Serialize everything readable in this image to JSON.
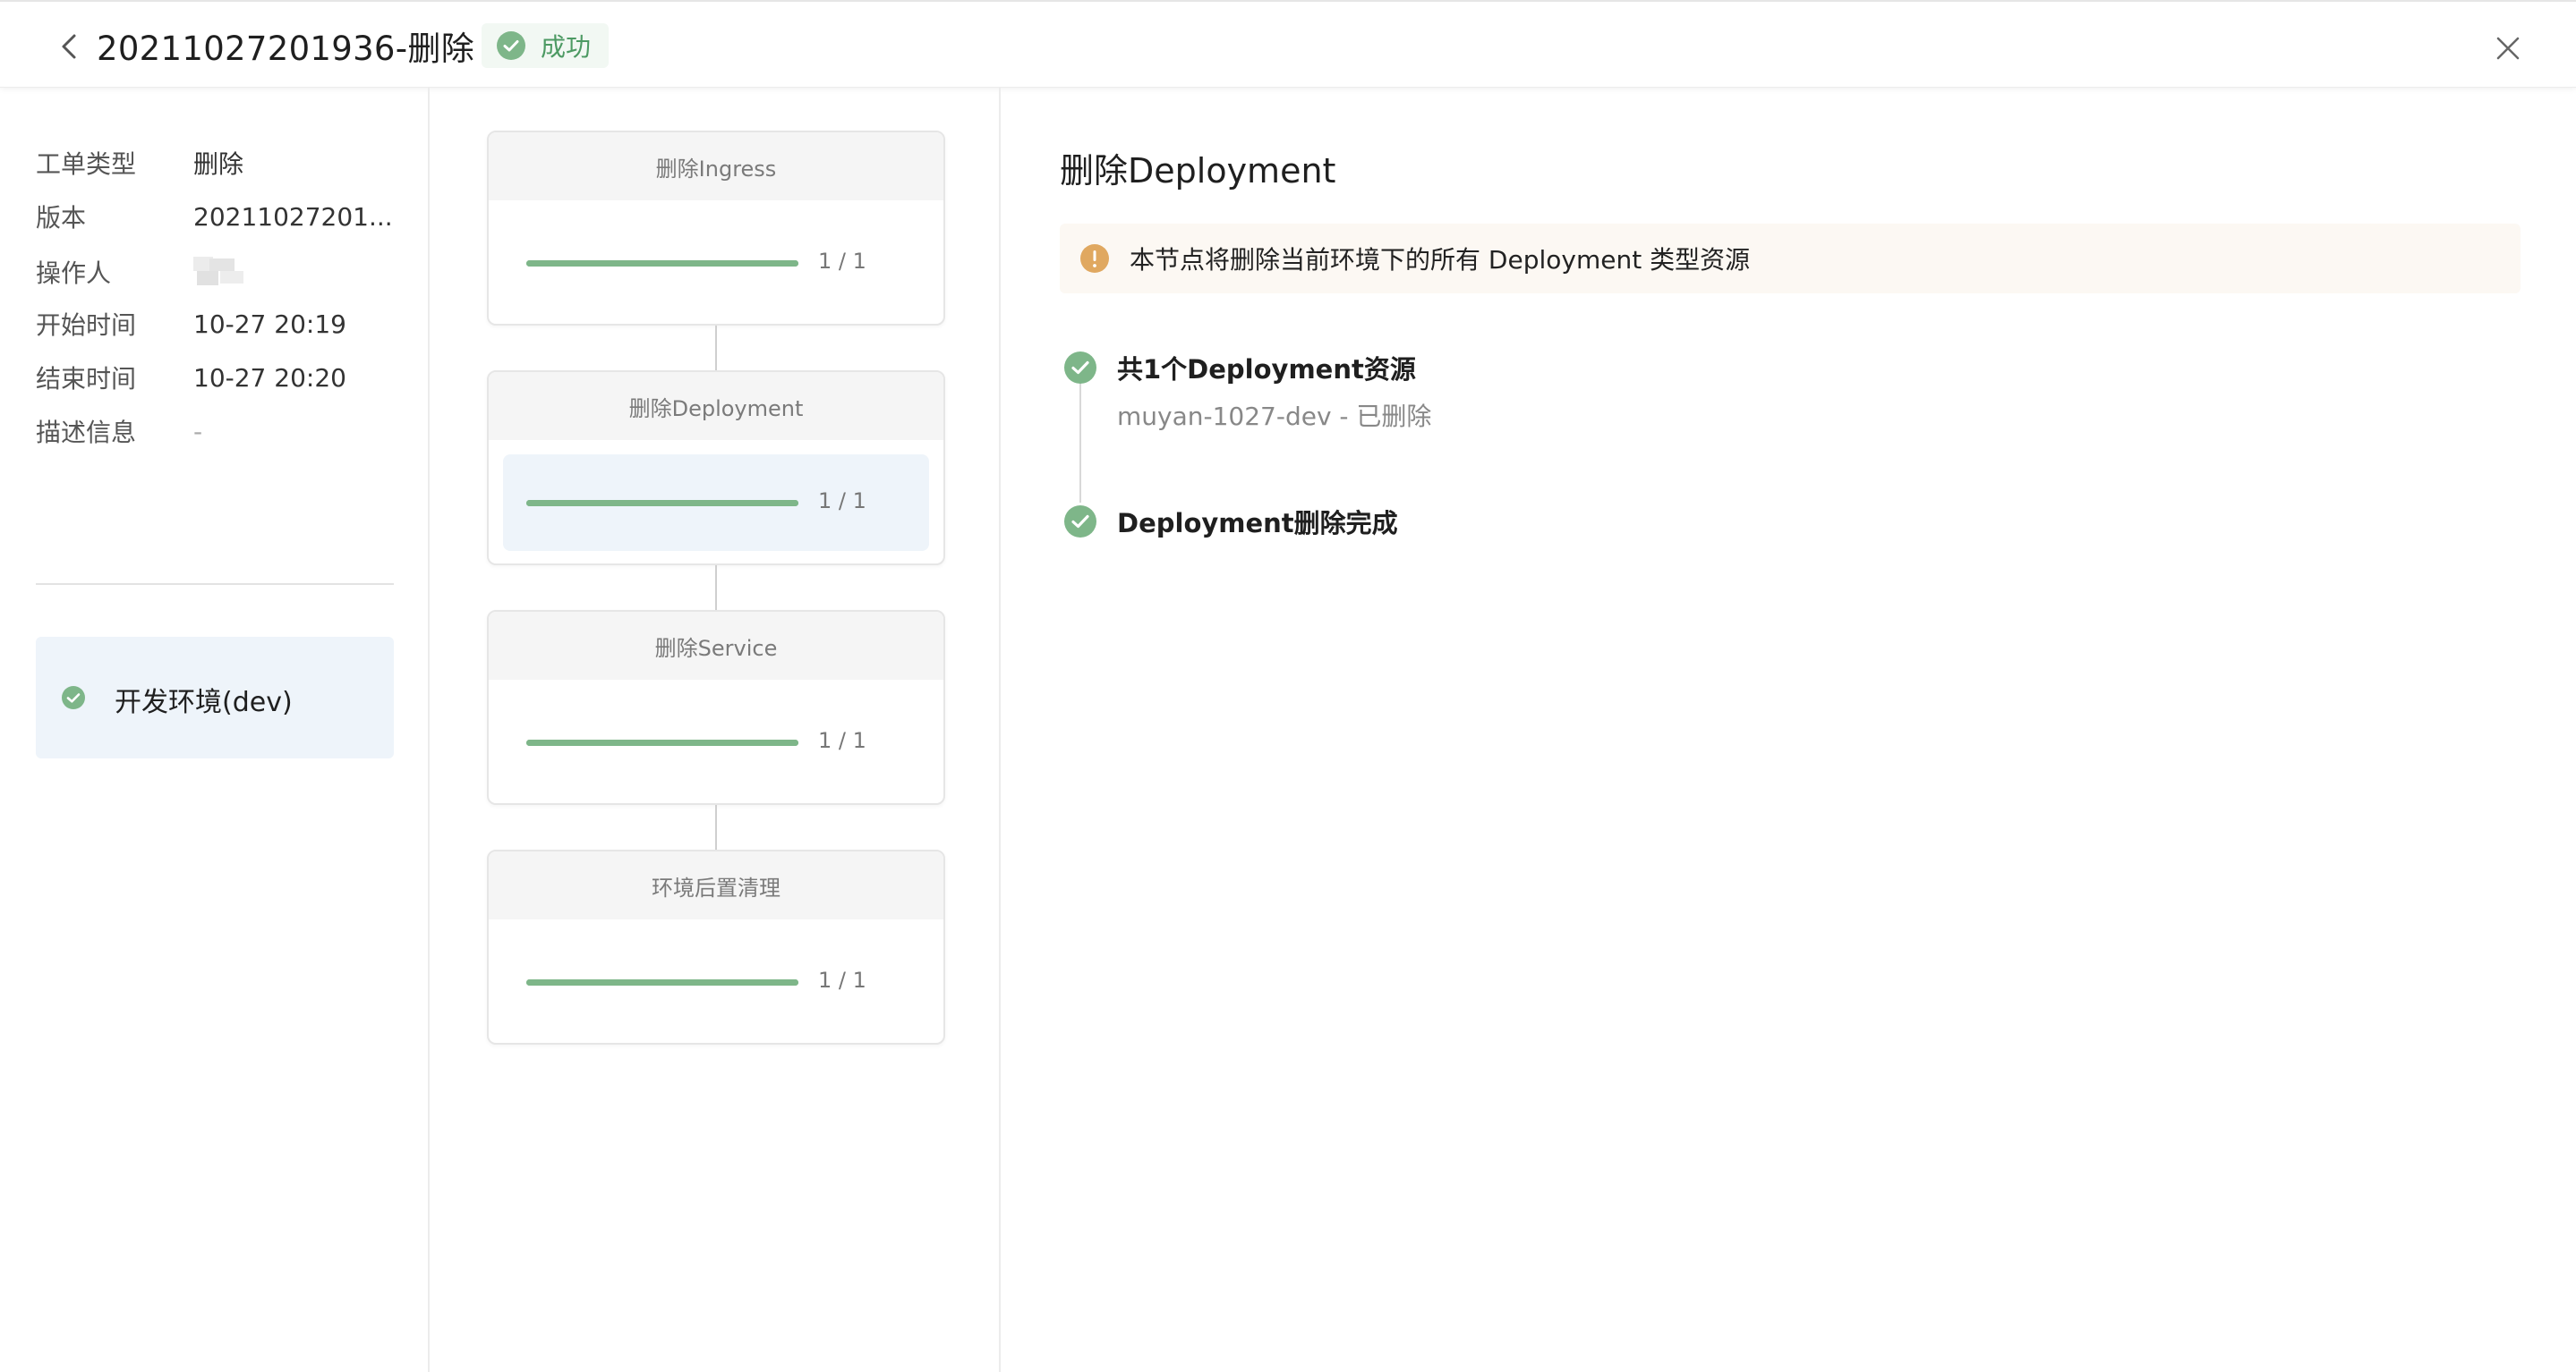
{
  "header": {
    "title": "20211027201936-删除",
    "status": "成功"
  },
  "info": {
    "rows": [
      {
        "label": "工单类型",
        "value": "删除"
      },
      {
        "label": "版本",
        "value": "20211027201..."
      },
      {
        "label": "操作人",
        "value": ""
      },
      {
        "label": "开始时间",
        "value": "10-27 20:19"
      },
      {
        "label": "结束时间",
        "value": "10-27 20:20"
      },
      {
        "label": "描述信息",
        "value": "-"
      }
    ]
  },
  "environments": [
    {
      "label": "开发环境(dev)",
      "status": "success"
    }
  ],
  "steps": [
    {
      "name": "删除Ingress",
      "progress_text": "1 / 1",
      "progress": 1.0,
      "active": false
    },
    {
      "name": "删除Deployment",
      "progress_text": "1 / 1",
      "progress": 1.0,
      "active": true
    },
    {
      "name": "删除Service",
      "progress_text": "1 / 1",
      "progress": 1.0,
      "active": false
    },
    {
      "name": "环境后置清理",
      "progress_text": "1 / 1",
      "progress": 1.0,
      "active": false
    }
  ],
  "detail": {
    "title": "删除Deployment",
    "alert": "本节点将删除当前环境下的所有 Deployment 类型资源",
    "timeline": [
      {
        "title": "共1个Deployment资源",
        "sub": "muyan-1027-dev - 已删除"
      },
      {
        "title": "Deployment删除完成",
        "sub": ""
      }
    ]
  },
  "colors": {
    "success": "#7eb689",
    "success_text": "#4d9a63",
    "warning": "#e0a860",
    "active_bg": "#eef4fa"
  }
}
